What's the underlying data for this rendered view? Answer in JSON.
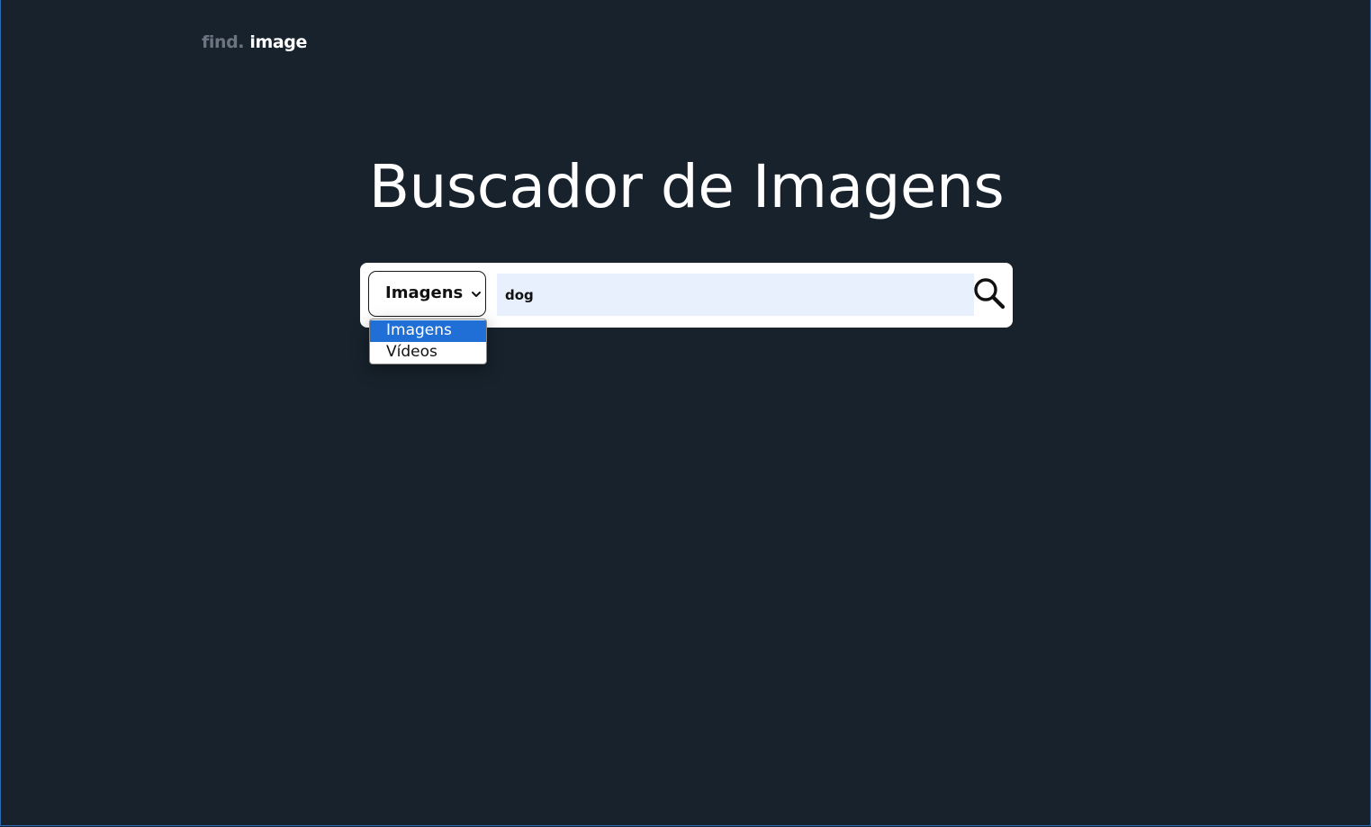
{
  "header": {
    "logo_part1": "find.",
    "logo_part2": "image"
  },
  "main": {
    "title": "Buscador de Imagens"
  },
  "search": {
    "type_select": {
      "selected": "Imagens",
      "options": [
        "Imagens",
        "Vídeos"
      ],
      "highlighted_index": 0,
      "expanded": true
    },
    "query_value": "dog",
    "button_icon": "magnifier-icon"
  },
  "colors": {
    "background": "#17222c",
    "logo_muted": "#6b7480",
    "text": "#ffffff",
    "input_fill": "#e8f0fe",
    "option_highlight": "#1f6fd6"
  }
}
